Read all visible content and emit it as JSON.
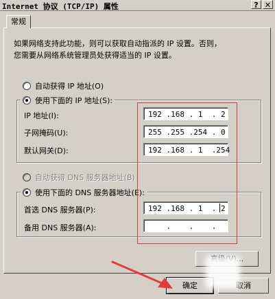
{
  "window": {
    "title": "Internet 协议 (TCP/IP) 属性",
    "help_button": "?",
    "close_button": "✕"
  },
  "tab": {
    "label": "常规"
  },
  "intro": {
    "line1": "如果网络支持此功能，则可以获取自动指派的 IP 设置。否则，",
    "line2": "您需要从网络系统管理员处获得适当的 IP 设置。"
  },
  "ip": {
    "auto_label": "自动获得 IP 地址(O)",
    "manual_label": "使用下面的 IP 地址(S):",
    "address_label": "IP 地址(I):",
    "address_value": "192 .168 . 1  . 2",
    "mask_label": "子网掩码(U):",
    "mask_value": "255 .255 .254 . 0",
    "gateway_label": "默认网关(D):",
    "gateway_value": "192 .168 . 1  .254"
  },
  "dns": {
    "auto_label": "自动获得 DNS 服务器地址(B)",
    "manual_label": "使用下面的 DNS 服务器地址(E):",
    "preferred_label": "首选 DNS 服务器(P):",
    "preferred_value": "192 .168 . 1  . 2",
    "alternate_label": "备用 DNS 服务器(A):",
    "alternate_value": "    .    .    .   "
  },
  "buttons": {
    "advanced": "高级(V)...",
    "ok": "确定",
    "cancel": "取消"
  },
  "colors": {
    "dialog_bg": "#d4d0c8",
    "annotation_red": "#e23b3b"
  }
}
